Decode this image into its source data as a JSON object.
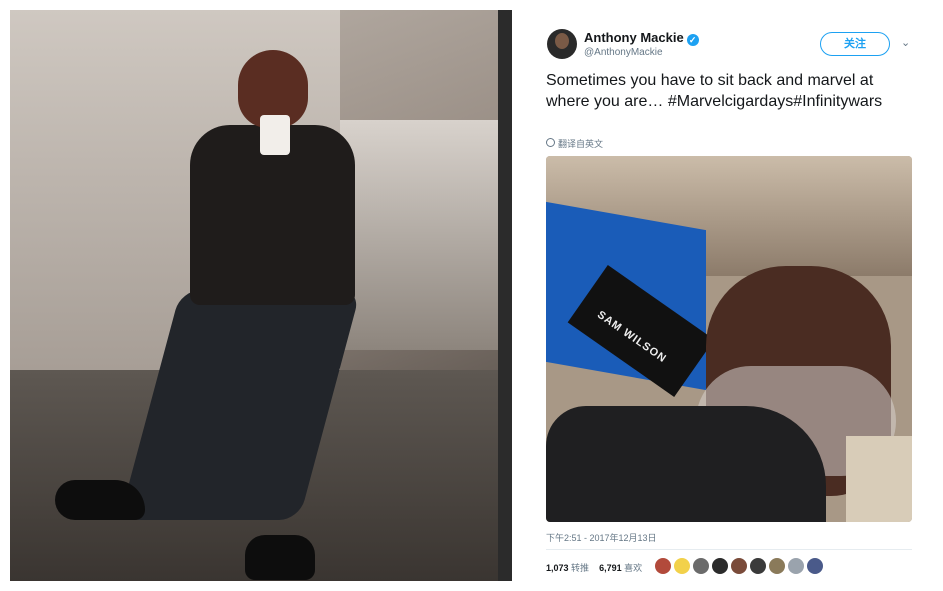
{
  "tweet": {
    "display_name": "Anthony Mackie",
    "handle": "@AnthonyMackie",
    "follow_label": "关注",
    "text": "Sometimes you have to sit back and marvel at where you are… #Marvelcigardays#Infinitywars",
    "translate_label": "翻译自英文",
    "timestamp": "下午2:51 - 2017年12月13日",
    "retweets_count": "1,073",
    "retweets_label": "转推",
    "likes_count": "6,791",
    "likes_label": "喜欢",
    "chair_text": "SAM WILSON"
  },
  "colors": {
    "accent": "#1da1f2",
    "text": "#14171a",
    "secondary": "#657786"
  },
  "icons": [
    "verified-badge-icon",
    "chevron-down-icon",
    "globe-icon"
  ],
  "likers": [
    {
      "color": "#b24a3b"
    },
    {
      "color": "#f2d14a"
    },
    {
      "color": "#6b6b6b"
    },
    {
      "color": "#2b2b2b"
    },
    {
      "color": "#7a4b3a"
    },
    {
      "color": "#3a3a3a"
    },
    {
      "color": "#8a7a5a"
    },
    {
      "color": "#9aa3ad"
    },
    {
      "color": "#4a5a8a"
    }
  ]
}
